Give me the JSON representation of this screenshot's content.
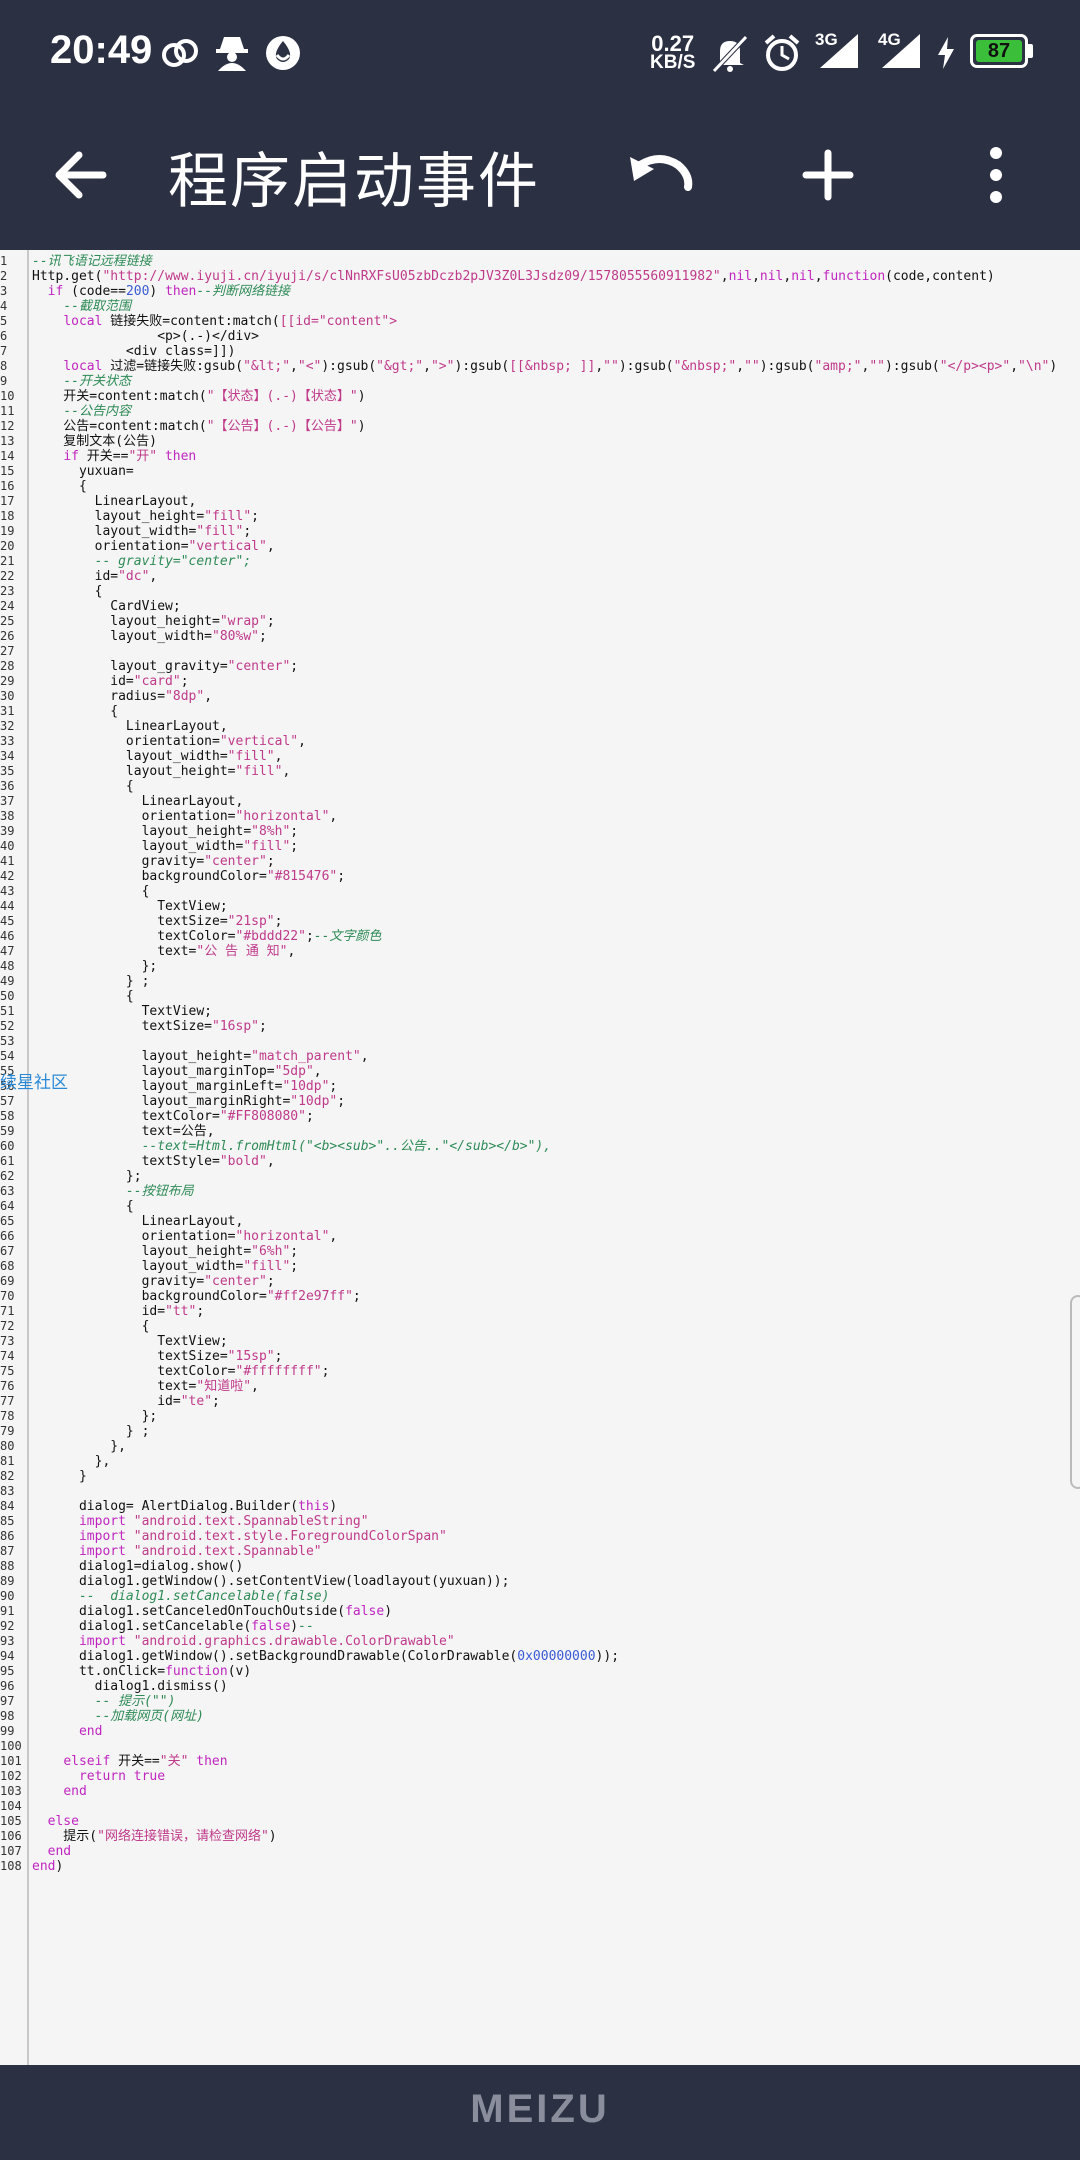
{
  "status_bar": {
    "time": "20:49",
    "net_speed_value": "0.27",
    "net_speed_unit": "KB/S",
    "network_3g": "3G",
    "network_4g": "4G",
    "battery_level": "87",
    "icons": [
      "link-icon",
      "incognito-icon",
      "droplet-icon",
      "mute-bell-icon",
      "alarm-icon",
      "signal-3g-icon",
      "signal-4g-icon",
      "charging-icon",
      "battery-icon"
    ]
  },
  "toolbar": {
    "title": "程序启动事件",
    "back_icon": "back-arrow-icon",
    "undo_icon": "undo-icon",
    "add_icon": "plus-icon",
    "menu_icon": "more-vert-icon"
  },
  "editor": {
    "overlay_label": "续星社区",
    "lines": [
      "--讯飞语记远程链接",
      "Http.get(\"http://www.iyuji.cn/iyuji/s/clNnRXFsU05zbDczb2pJV3Z0L3Jsdz09/1578055560911982\",nil,nil,nil,function(code,content)",
      "  if (code==200) then--判断网络链接",
      "    --截取范围",
      "    local 链接失败=content:match([[id=\"content\">",
      "                <p>(.-)</div>",
      "            <div class=]])",
      "    local 过滤=链接失败:gsub(\"&lt;\",\"<\"):gsub(\"&gt;\",\">\"):gsub([[&nbsp; ]],\"\"):gsub(\"&nbsp;\",\"\"):gsub(\"amp;\",\"\"):gsub(\"</p><p>\",\"\\n\")",
      "    --开关状态",
      "    开关=content:match(\"【状态】(.-)【状态】\")",
      "    --公告内容",
      "    公告=content:match(\"【公告】(.-)【公告】\")",
      "    复制文本(公告)",
      "    if 开关==\"开\" then",
      "      yuxuan=",
      "      {",
      "        LinearLayout,",
      "        layout_height=\"fill\";",
      "        layout_width=\"fill\";",
      "        orientation=\"vertical\",",
      "        -- gravity=\"center\";",
      "        id=\"dc\",",
      "        {",
      "          CardView;",
      "          layout_height=\"wrap\";",
      "          layout_width=\"80%w\";",
      "",
      "          layout_gravity=\"center\";",
      "          id=\"card\";",
      "          radius=\"8dp\",",
      "          {",
      "            LinearLayout,",
      "            orientation=\"vertical\",",
      "            layout_width=\"fill\",",
      "            layout_height=\"fill\",",
      "            {",
      "              LinearLayout,",
      "              orientation=\"horizontal\",",
      "              layout_height=\"8%h\";",
      "              layout_width=\"fill\";",
      "              gravity=\"center\";",
      "              backgroundColor=\"#815476\";",
      "              {",
      "                TextView;",
      "                textSize=\"21sp\";",
      "                textColor=\"#bddd22\";--文字颜色",
      "                text=\"公 告 通 知\",",
      "              };",
      "            } ;",
      "            {",
      "              TextView;",
      "              textSize=\"16sp\";",
      "",
      "              layout_height=\"match_parent\",",
      "              layout_marginTop=\"5dp\",",
      "              layout_marginLeft=\"10dp\";",
      "              layout_marginRight=\"10dp\";",
      "              textColor=\"#FF808080\";",
      "              text=公告,",
      "              --text=Html.fromHtml(\"<b><sub>\"..公告..\"</sub></b>\"),",
      "              textStyle=\"bold\",",
      "            };",
      "            --按钮布局",
      "            {",
      "              LinearLayout,",
      "              orientation=\"horizontal\",",
      "              layout_height=\"6%h\";",
      "              layout_width=\"fill\";",
      "              gravity=\"center\";",
      "              backgroundColor=\"#ff2e97ff\";",
      "              id=\"tt\";",
      "              {",
      "                TextView;",
      "                textSize=\"15sp\";",
      "                textColor=\"#ffffffff\";",
      "                text=\"知道啦\",",
      "                id=\"te\";",
      "              };",
      "            } ;",
      "          },",
      "        },",
      "      }",
      "",
      "      dialog= AlertDialog.Builder(this)",
      "      import \"android.text.SpannableString\"",
      "      import \"android.text.style.ForegroundColorSpan\"",
      "      import \"android.text.Spannable\"",
      "      dialog1=dialog.show()",
      "      dialog1.getWindow().setContentView(loadlayout(yuxuan));",
      "      --  dialog1.setCancelable(false)",
      "      dialog1.setCanceledOnTouchOutside(false)",
      "      dialog1.setCancelable(false)--",
      "      import \"android.graphics.drawable.ColorDrawable\"",
      "      dialog1.getWindow().setBackgroundDrawable(ColorDrawable(0x00000000));",
      "      tt.onClick=function(v)",
      "        dialog1.dismiss()",
      "        -- 提示(\"\")",
      "        --加载网页(网址)",
      "      end",
      "",
      "    elseif 开关==\"关\" then",
      "      return true",
      "    end",
      "",
      "  else",
      "    提示(\"网络连接错误，请检查网络\")",
      "  end",
      "end)"
    ]
  },
  "nav_bar": {
    "brand": "MEIZU"
  },
  "colors": {
    "bar_bg": "#2b3042",
    "editor_bg": "#f5f5f5",
    "keyword": "#c026c0",
    "string": "#c03a8a",
    "comment": "#2e8b57",
    "number": "#3a5bd6",
    "battery": "#3bbf3b"
  }
}
